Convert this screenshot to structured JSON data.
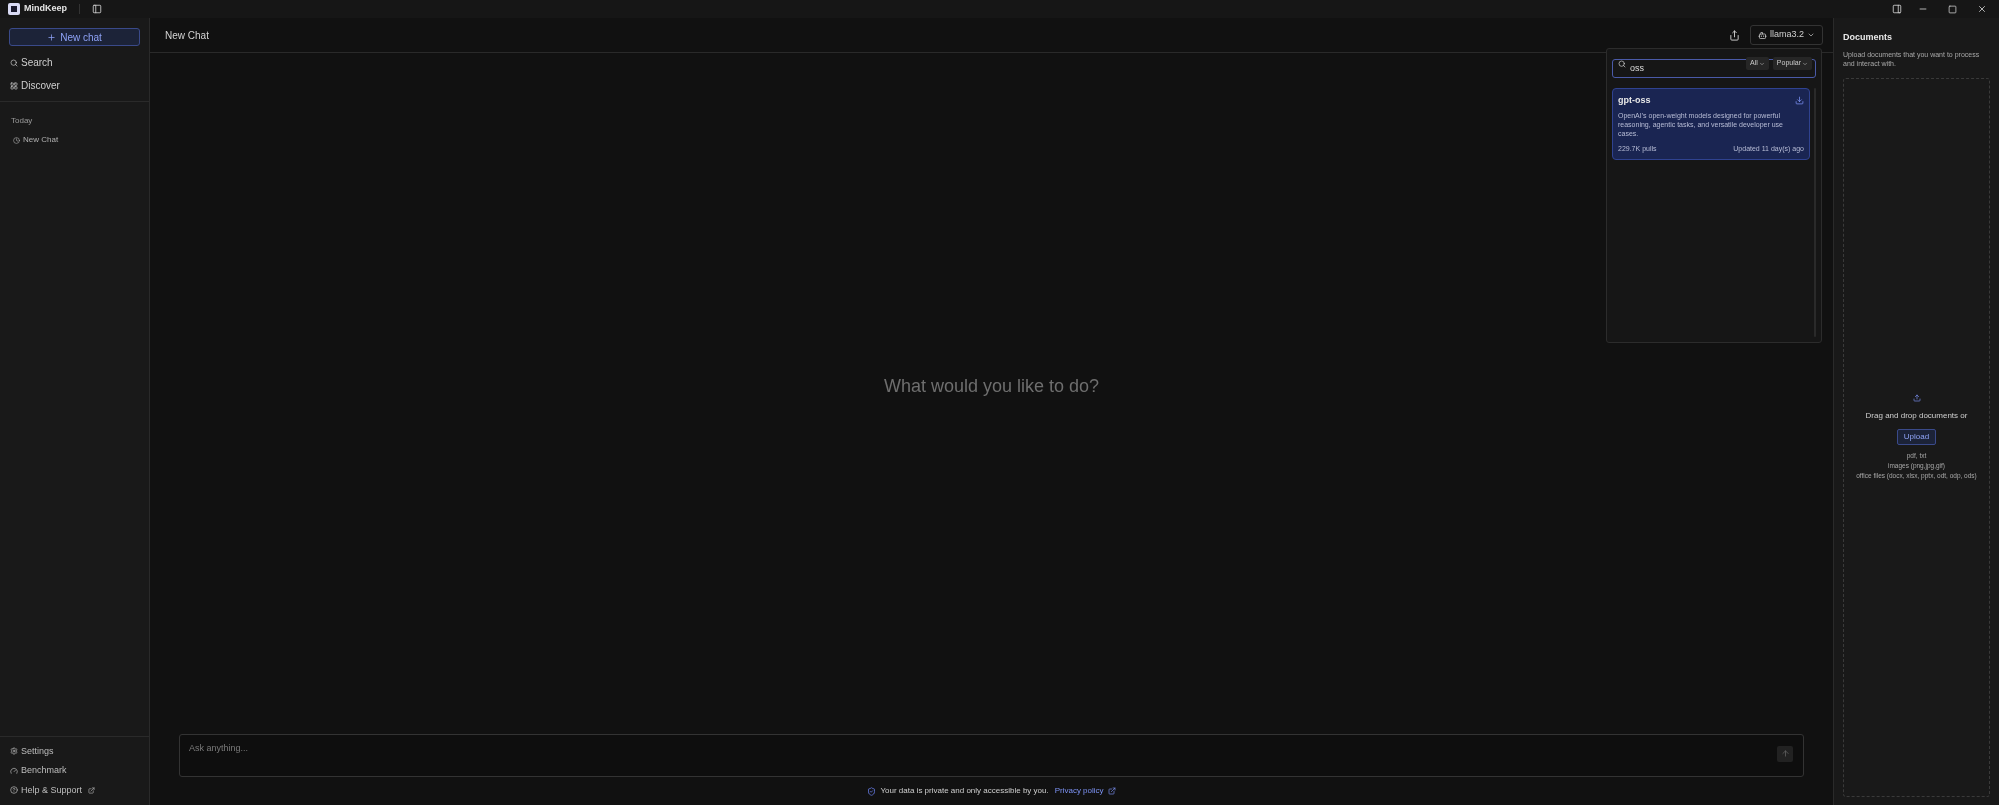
{
  "app": {
    "name": "MindKeep"
  },
  "sidebar": {
    "new_chat": "New chat",
    "nav": [
      {
        "kind": "search",
        "label": "Search"
      },
      {
        "kind": "discover",
        "label": "Discover"
      }
    ],
    "history": {
      "heading": "Today",
      "items": [
        {
          "label": "New Chat",
          "selected": false
        }
      ]
    },
    "footer": [
      {
        "kind": "settings",
        "label": "Settings",
        "external": false
      },
      {
        "kind": "benchmark",
        "label": "Benchmark",
        "external": false
      },
      {
        "kind": "help",
        "label": "Help & Support",
        "external": true
      }
    ]
  },
  "chat": {
    "title": "New Chat",
    "model": "llama3.2",
    "empty_prompt": "What would you like to do?",
    "input_placeholder": "Ask anything...",
    "privacy_note": "Your data is private and only accessible by you.",
    "privacy_link": "Privacy policy"
  },
  "model_picker": {
    "query": "oss",
    "filters": [
      "All",
      "Popular"
    ],
    "results": [
      {
        "name": "gpt-oss",
        "description": "OpenAI's open-weight models designed for powerful reasoning, agentic tasks, and versatile developer use cases.",
        "pulls": "229.7K pulls",
        "updated": "Updated 11 day(s) ago",
        "selected": true
      }
    ]
  },
  "documents": {
    "title": "Documents",
    "subtitle": "Upload documents that you want to process and interact with.",
    "drop_text": "Drag and drop documents or",
    "upload": "Upload",
    "formats": [
      "pdf, txt",
      "images (png,jpg,gif)",
      "office files (docx, xlsx, pptx, odt, odp, ods)"
    ]
  }
}
